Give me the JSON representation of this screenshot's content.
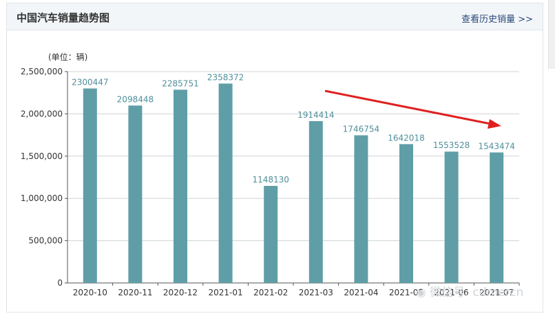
{
  "panel": {
    "title": "中国汽车销量趋势图",
    "history_link": "查看历史销量"
  },
  "chart_data": {
    "type": "bar",
    "title": "",
    "unit_label": "(单位：辆)",
    "categories": [
      "2020-10",
      "2020-11",
      "2020-12",
      "2021-01",
      "2021-02",
      "2021-03",
      "2021-04",
      "2021-05",
      "2021-06",
      "2021-07"
    ],
    "values": [
      2300447,
      2098448,
      2285751,
      2358372,
      1148130,
      1914414,
      1746754,
      1642018,
      1553528,
      1543474
    ],
    "xlabel": "",
    "ylabel": "",
    "ylim": [
      0,
      2500000
    ],
    "yticks": [
      "0",
      "500,000",
      "1,000,000",
      "1,500,000",
      "2,000,000",
      "2,500,000"
    ],
    "bar_color": "#5f9ea7",
    "label_color": "#4f8f9a",
    "grid": true,
    "annotation": {
      "type": "arrow",
      "color": "#e02020"
    }
  },
  "watermark": "微信号: cdmercn"
}
